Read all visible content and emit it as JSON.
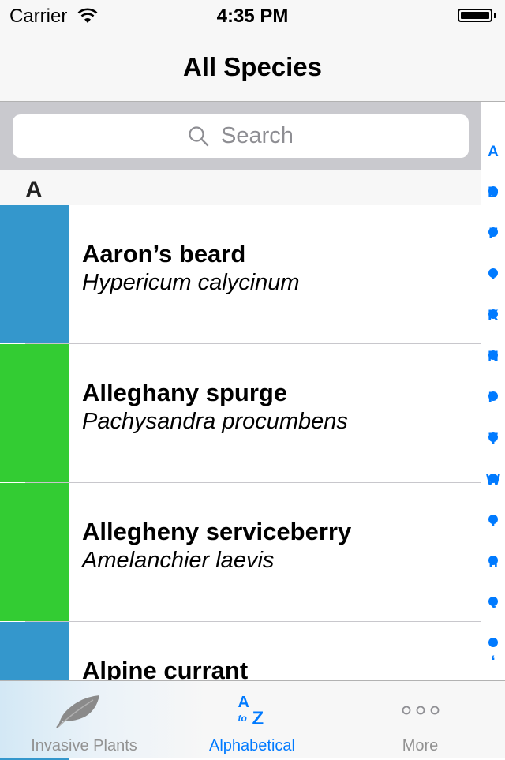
{
  "status_bar": {
    "carrier": "Carrier",
    "time": "4:35 PM",
    "battery_level": 1.0
  },
  "nav": {
    "title": "All Species"
  },
  "search": {
    "placeholder": "Search",
    "icon": "search-icon"
  },
  "sections": [
    {
      "title": "A",
      "rows": [
        {
          "common_name": "Aaron’s beard",
          "latin_name": "Hypericum calycinum",
          "color": "#3497cc"
        },
        {
          "common_name": "Alleghany spurge",
          "latin_name": "Pachysandra procumbens",
          "color": "#33cc33"
        },
        {
          "common_name": "Allegheny serviceberry",
          "latin_name": "Amelanchier laevis",
          "color": "#33cc33"
        },
        {
          "common_name": "Alpine currant",
          "latin_name": "",
          "color": "#3497cc"
        }
      ]
    }
  ],
  "index": {
    "items": [
      "A",
      "•",
      "D",
      "•",
      "F",
      "•",
      "I",
      "•",
      "K",
      "•",
      "N",
      "•",
      "P",
      "•",
      "T",
      "•",
      "W",
      "•",
      "f",
      "•",
      "n",
      "•",
      "t",
      "•",
      "‘"
    ],
    "color": "#007aff"
  },
  "tab_bar": {
    "tabs": [
      {
        "label": "Invasive Plants",
        "icon": "leaf-icon",
        "active": false
      },
      {
        "label": "Alphabetical",
        "icon": "a-to-z-icon",
        "active": true
      },
      {
        "label": "More",
        "icon": "more-icon",
        "active": false
      }
    ],
    "az_icon": {
      "top": "A",
      "middle": "to",
      "bottom": "Z"
    }
  }
}
